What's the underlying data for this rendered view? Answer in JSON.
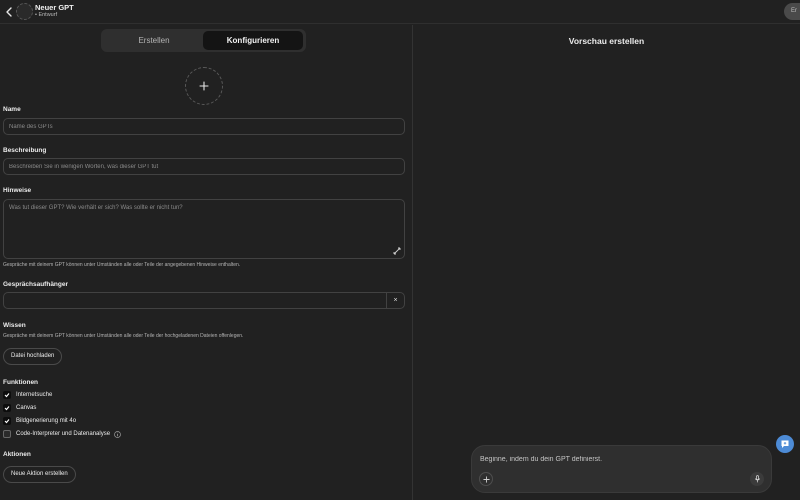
{
  "header": {
    "title": "Neuer GPT",
    "status": "• Entwurf",
    "publish_label": "Er"
  },
  "tabs": [
    {
      "label": "Erstellen",
      "active": false
    },
    {
      "label": "Konfigurieren",
      "active": true
    }
  ],
  "form": {
    "name": {
      "label": "Name",
      "placeholder": "Name des GPTs",
      "value": ""
    },
    "description": {
      "label": "Beschreibung",
      "placeholder": "Beschreiben Sie in wenigen Worten, was dieser GPT tut",
      "value": ""
    },
    "instructions": {
      "label": "Hinweise",
      "placeholder": "Was tut dieser GPT? Wie verhält er sich? Was sollte er nicht tun?",
      "hint": "Gespräche mit deinem GPT können unter Umständen alle oder Teile der angegebenen Hinweise enthalten."
    },
    "starters": {
      "label": "Gesprächsaufhänger",
      "value": "",
      "clear": "×"
    },
    "knowledge": {
      "label": "Wissen",
      "hint": "Gespräche mit deinem GPT können unter Umständen alle oder Teile der hochgeladenen Dateien offenlegen.",
      "upload_label": "Datei hochladen"
    },
    "capabilities": {
      "label": "Funktionen",
      "items": [
        {
          "label": "Internetsuche",
          "checked": true
        },
        {
          "label": "Canvas",
          "checked": true
        },
        {
          "label": "Bildgenerierung mit 4o",
          "checked": true
        },
        {
          "label": "Code-Interpreter und Datenanalyse",
          "checked": false
        }
      ]
    },
    "actions": {
      "label": "Aktionen",
      "create_label": "Neue Aktion erstellen"
    }
  },
  "preview": {
    "title": "Vorschau erstellen",
    "composer_placeholder": "Beginne, indem du dein GPT definierst."
  },
  "icons": {
    "back": "chevron-left-icon",
    "upload": "plus-icon",
    "resize": "resize-grip-icon",
    "check": "check-icon",
    "info": "info-icon",
    "composer_plus": "plus-icon",
    "mic": "microphone-icon",
    "help": "chat-help-icon"
  },
  "colors": {
    "background": "#212121",
    "surface": "#2f2f2f",
    "border": "#424242",
    "text": "#ececec",
    "accent": "#4d8bd6"
  }
}
